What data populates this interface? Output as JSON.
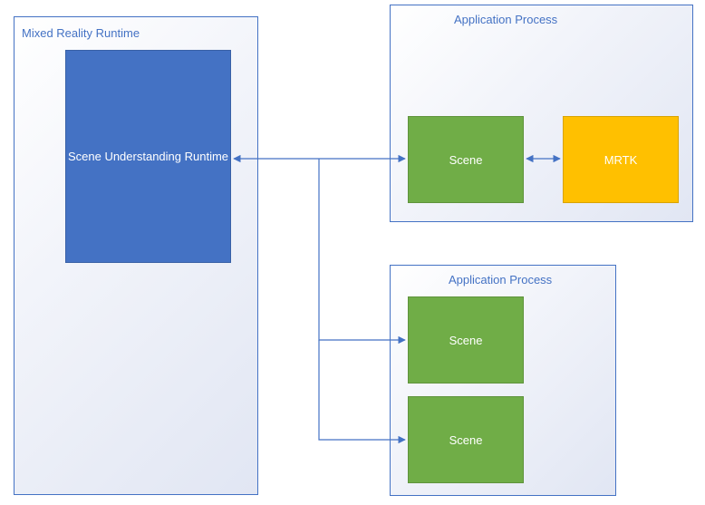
{
  "containers": {
    "runtime": {
      "title": "Mixed Reality Runtime"
    },
    "app1": {
      "title": "Application Process"
    },
    "app2": {
      "title": "Application Process"
    }
  },
  "blocks": {
    "su_runtime": "Scene Understanding Runtime",
    "scene_a": "Scene",
    "mrtk": "MRTK",
    "scene_b": "Scene",
    "scene_c": "Scene"
  },
  "colors": {
    "accent": "#4472C4",
    "green": "#70AD47",
    "yellow": "#FFC000"
  }
}
